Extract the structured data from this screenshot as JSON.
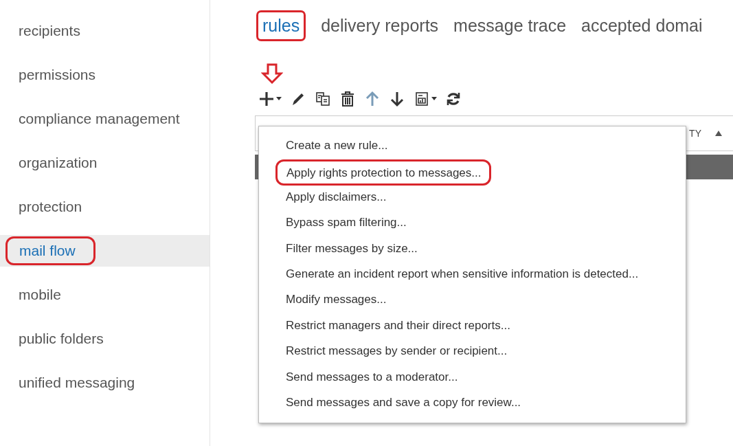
{
  "sidebar": {
    "items": [
      {
        "label": "recipients",
        "selected": false,
        "annotated": false
      },
      {
        "label": "permissions",
        "selected": false,
        "annotated": false
      },
      {
        "label": "compliance management",
        "selected": false,
        "annotated": false
      },
      {
        "label": "organization",
        "selected": false,
        "annotated": false
      },
      {
        "label": "protection",
        "selected": false,
        "annotated": false
      },
      {
        "label": "mail flow",
        "selected": true,
        "annotated": true
      },
      {
        "label": "mobile",
        "selected": false,
        "annotated": false
      },
      {
        "label": "public folders",
        "selected": false,
        "annotated": false
      },
      {
        "label": "unified messaging",
        "selected": false,
        "annotated": false
      }
    ]
  },
  "tabs": [
    {
      "label": "rules",
      "selected": true,
      "annotated": true
    },
    {
      "label": "delivery reports",
      "selected": false,
      "annotated": false
    },
    {
      "label": "message trace",
      "selected": false,
      "annotated": false
    },
    {
      "label": "accepted domai",
      "selected": false,
      "annotated": false
    }
  ],
  "toolbar": [
    {
      "kind": "add",
      "disabled": false
    },
    {
      "kind": "edit",
      "disabled": false
    },
    {
      "kind": "copy",
      "disabled": false
    },
    {
      "kind": "delete",
      "disabled": false
    },
    {
      "kind": "up",
      "disabled": true
    },
    {
      "kind": "down",
      "disabled": false
    },
    {
      "kind": "report",
      "disabled": false
    },
    {
      "kind": "refresh",
      "disabled": false
    }
  ],
  "add_button_pointer": true,
  "table": {
    "column_1": "TY"
  },
  "menu": {
    "items": [
      {
        "label": "Create a new rule...",
        "annotated": false
      },
      {
        "label": "Apply rights protection to messages...",
        "annotated": true
      },
      {
        "label": "Apply disclaimers...",
        "annotated": false
      },
      {
        "label": "Bypass spam filtering...",
        "annotated": false
      },
      {
        "label": "Filter messages by size...",
        "annotated": false
      },
      {
        "label": "Generate an incident report when sensitive information is detected...",
        "annotated": false
      },
      {
        "label": "Modify messages...",
        "annotated": false
      },
      {
        "label": "Restrict managers and their direct reports...",
        "annotated": false
      },
      {
        "label": "Restrict messages by sender or recipient...",
        "annotated": false
      },
      {
        "label": "Send messages to a moderator...",
        "annotated": false
      },
      {
        "label": "Send messages and save a copy for review...",
        "annotated": false
      }
    ]
  }
}
